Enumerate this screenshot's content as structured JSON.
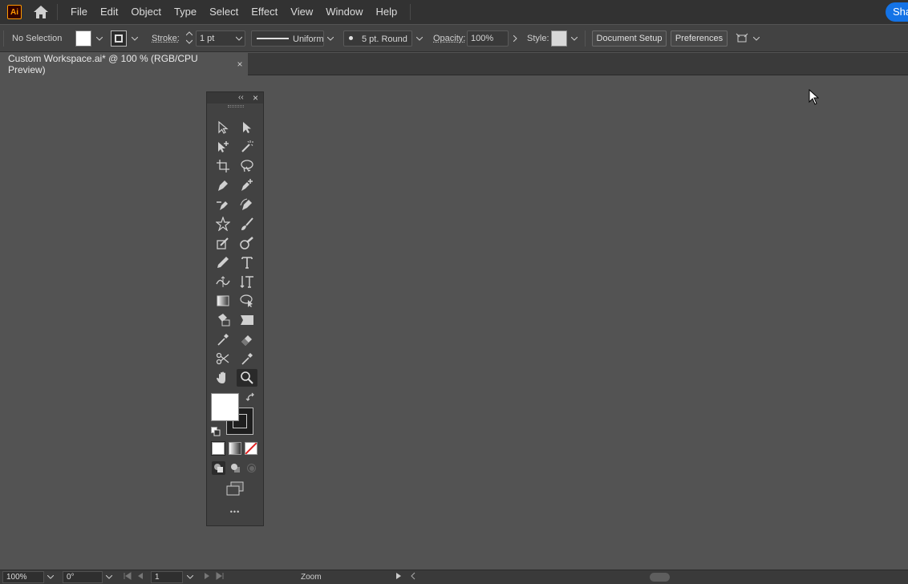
{
  "app": {
    "logo_text": "Ai"
  },
  "menu": {
    "items": [
      "File",
      "Edit",
      "Object",
      "Type",
      "Select",
      "Effect",
      "View",
      "Window",
      "Help"
    ],
    "share_label": "Sha"
  },
  "control_bar": {
    "selection_status": "No Selection",
    "stroke_label": "Stroke:",
    "stroke_weight": "1 pt",
    "stroke_profile": "Uniform",
    "brush": "5 pt. Round",
    "opacity_label": "Opacity:",
    "opacity_value": "100%",
    "style_label": "Style:",
    "document_setup_label": "Document Setup",
    "preferences_label": "Preferences",
    "fill_color": "#ffffff"
  },
  "document": {
    "tab_title": "Custom Workspace.ai* @ 100 % (RGB/CPU Preview)",
    "close_glyph": "×"
  },
  "tools_panel": {
    "collapse_glyph": "‹‹",
    "close_glyph": "×",
    "more_glyph": "•••",
    "active_tool": "zoom-tool",
    "fill_color": "#ffffff",
    "stroke_color": "#1e1e1e"
  },
  "status_bar": {
    "zoom_value": "100%",
    "rotation_value": "0°",
    "artboard_value": "1",
    "tool_label": "Zoom"
  },
  "colors": {
    "canvas": "#535353",
    "accent": "#1473e6",
    "logo_orange": "#ff9a00"
  }
}
